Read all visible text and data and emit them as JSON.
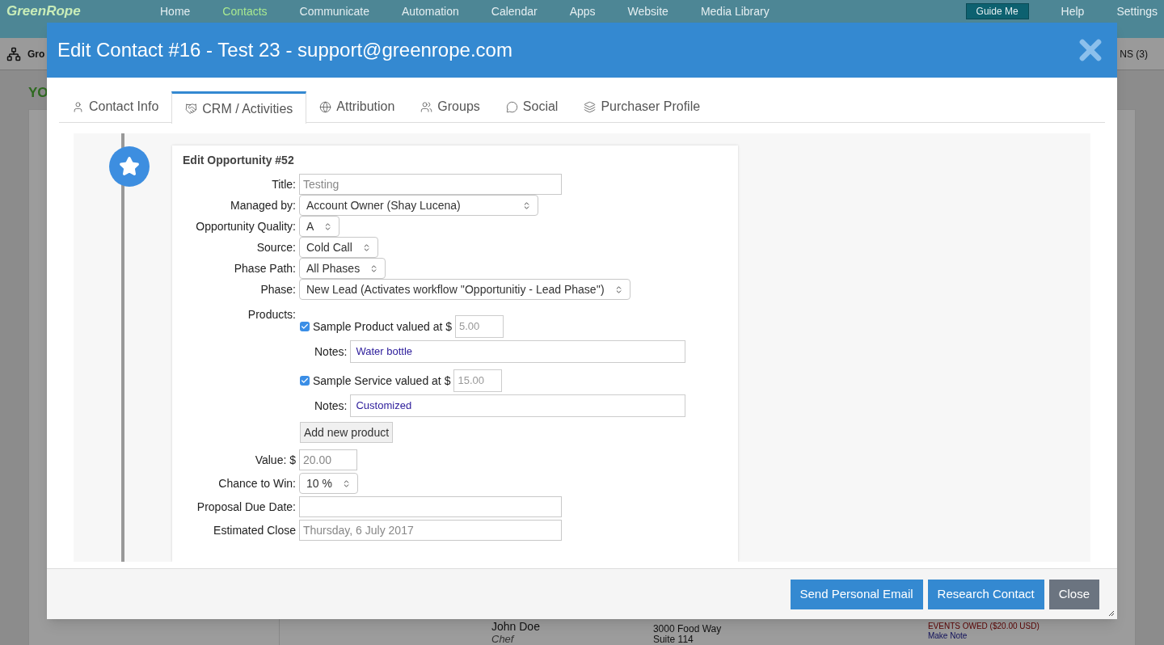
{
  "app_bar": {
    "logo": "GreenRope",
    "nav": [
      {
        "label": "Home",
        "selected": false
      },
      {
        "label": "Contacts",
        "selected": true
      },
      {
        "label": "Communicate",
        "selected": false
      },
      {
        "label": "Automation",
        "selected": false
      },
      {
        "label": "Calendar",
        "selected": false
      },
      {
        "label": "Apps",
        "selected": false
      },
      {
        "label": "Website",
        "selected": false
      },
      {
        "label": "Media Library",
        "selected": false
      }
    ],
    "guide_button": "Guide Me",
    "links": [
      "Help",
      "Settings"
    ]
  },
  "sub_bar": {
    "title": "Gro",
    "right": "NS (3)"
  },
  "page": {
    "heading": "YO",
    "contact": {
      "name": "John Doe",
      "role": "Chef",
      "address": [
        "3000 Food Way",
        "Suite 114"
      ],
      "owed": "EVENTS OWED ($20.00 USD)",
      "note_link": "Make Note"
    }
  },
  "modal": {
    "title": "Edit Contact #16 - Test 23 - support@greenrope.com",
    "tabs": [
      {
        "label": "Contact Info",
        "selected": false
      },
      {
        "label": "CRM / Activities",
        "selected": true
      },
      {
        "label": "Attribution",
        "selected": false
      },
      {
        "label": "Groups",
        "selected": false
      },
      {
        "label": "Social",
        "selected": false
      },
      {
        "label": "Purchaser Profile",
        "selected": false
      }
    ],
    "opportunity": {
      "title": "Edit Opportunity #52",
      "fields": [
        {
          "label": "Title:",
          "kind": "text",
          "value": "Testing"
        },
        {
          "label": "Managed by:",
          "kind": "wide-select",
          "value": "Account Owner (Shay Lucena)"
        },
        {
          "label": "Opportunity Quality:",
          "kind": "select",
          "value": "A"
        },
        {
          "label": "Source:",
          "kind": "select",
          "value": "Cold Call"
        },
        {
          "label": "Phase Path:",
          "kind": "select",
          "value": "All Phases"
        },
        {
          "label": "Phase:",
          "kind": "select",
          "value": "New Lead (Activates workflow ''Opportunitiy - Lead Phase'')"
        }
      ],
      "products": {
        "label": "Products:",
        "items": [
          {
            "label": "Sample Product valued at $",
            "checked": true,
            "price": "5.00",
            "notes_label": "Notes:",
            "notes": "Water bottle"
          },
          {
            "label": "Sample Service valued at $",
            "checked": true,
            "price": "15.00",
            "notes_label": "Notes:",
            "notes": "Customized"
          }
        ],
        "add_button": "Add new product"
      },
      "more_fields": [
        {
          "label": "Value: $",
          "kind": "amount",
          "value": "20.00"
        },
        {
          "label": "Chance to Win:",
          "kind": "select",
          "value": "10 %"
        },
        {
          "label": "Proposal Due Date:",
          "kind": "text"
        },
        {
          "label": "Estimated Close",
          "kind": "text",
          "value": "Thursday, 6 July 2017"
        }
      ]
    }
  },
  "footer": {
    "buttons": [
      {
        "label": "Send Personal Email",
        "kind": "primary"
      },
      {
        "label": "Research Contact",
        "kind": "primary"
      },
      {
        "label": "Close",
        "kind": "secondary"
      }
    ]
  }
}
